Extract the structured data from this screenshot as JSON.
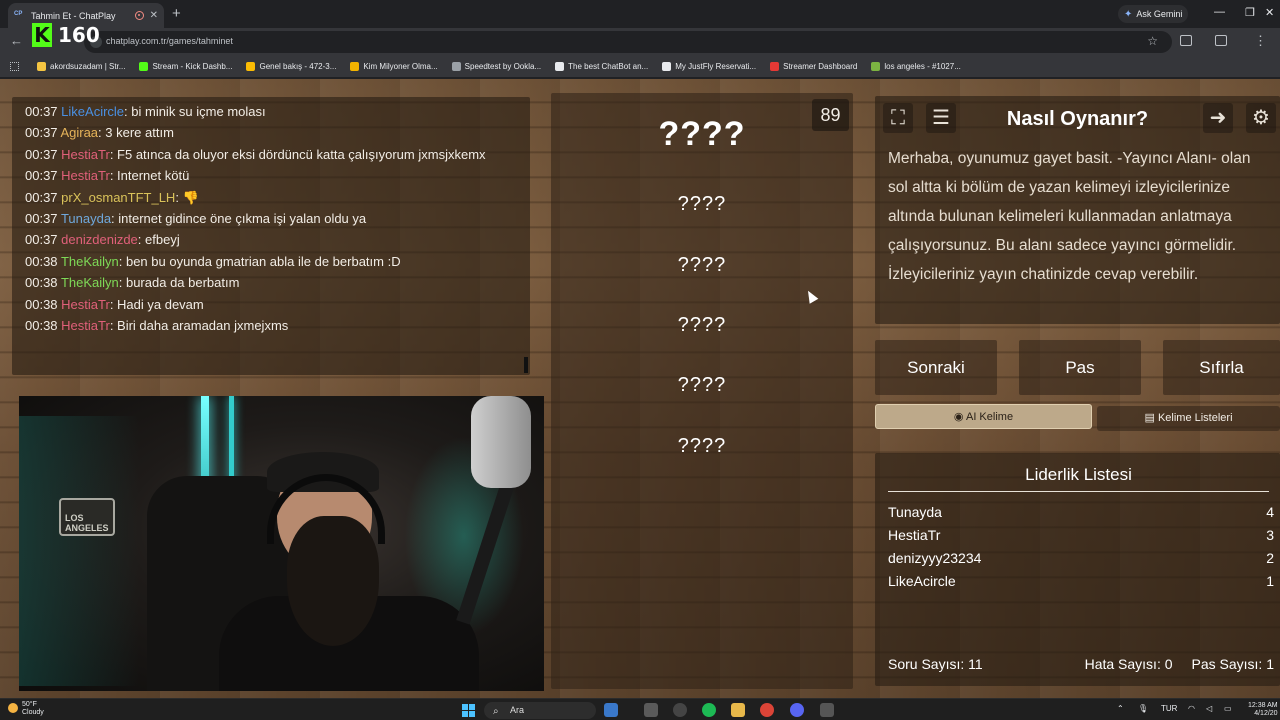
{
  "browser": {
    "tab_title": "Tahmin Et - ChatPlay",
    "tab_favicon": "CP",
    "gemini_label": "Ask Gemini",
    "url": "chatplay.com.tr/games/tahminet",
    "kick_viewers": "160",
    "bookmarks": [
      {
        "label": "akordsuzadam | Str...",
        "color": "#f5c542"
      },
      {
        "label": "Stream - Kick Dashb...",
        "color": "#53fc18"
      },
      {
        "label": "Genel bakış - 472-3...",
        "color": "#fbbc04"
      },
      {
        "label": "Kim Milyoner Olma...",
        "color": "#f4b400"
      },
      {
        "label": "Speedtest by Ookla...",
        "color": "#9aa0a6"
      },
      {
        "label": "The best ChatBot an...",
        "color": "#e8eaed"
      },
      {
        "label": "My JustFly Reservati...",
        "color": "#e8eaed"
      },
      {
        "label": "Streamer Dashboard",
        "color": "#e53935"
      },
      {
        "label": "los angeles - #1027...",
        "color": "#7cb342"
      }
    ]
  },
  "chat": {
    "messages": [
      {
        "time": "00:37",
        "user": "LikeAcircle",
        "color": "#4a90e2",
        "text": ": bi minik su içme molası"
      },
      {
        "time": "00:37",
        "user": "Agiraa",
        "color": "#e6b45a",
        "text": ": 3 kere attım"
      },
      {
        "time": "00:37",
        "user": "HestiaTr",
        "color": "#e0607a",
        "text": ": F5 atınca da oluyor eksi dördüncü katta çalışıyorum jxmsjxkemx"
      },
      {
        "time": "00:37",
        "user": "HestiaTr",
        "color": "#e0607a",
        "text": ": Internet kötü"
      },
      {
        "time": "00:37",
        "user": "prX_osmanTFT_LH",
        "color": "#d9c25a",
        "text": ": 👎"
      },
      {
        "time": "00:37",
        "user": "Tunayda",
        "color": "#6fa8dc",
        "text": ": internet gidince öne çıkma işi yalan oldu ya"
      },
      {
        "time": "00:37",
        "user": "denizdenizde",
        "color": "#e0607a",
        "text": ": efbeyj"
      },
      {
        "time": "00:38",
        "user": "TheKailyn",
        "color": "#7ed957",
        "text": ": ben bu oyunda gmatrian abla ile de berbatım :D"
      },
      {
        "time": "00:38",
        "user": "TheKailyn",
        "color": "#7ed957",
        "text": ": burada da berbatım"
      },
      {
        "time": "00:38",
        "user": "HestiaTr",
        "color": "#e0607a",
        "text": ": Hadi ya devam"
      },
      {
        "time": "00:38",
        "user": "HestiaTr",
        "color": "#e0607a",
        "text": ": Biri daha aramadan jxmejxms"
      }
    ]
  },
  "webcam": {
    "sign_text": "LOS ANGELES"
  },
  "game": {
    "timer": "89",
    "main_word": "????",
    "forbidden_words": [
      "????",
      "????",
      "????",
      "????",
      "????"
    ]
  },
  "info": {
    "title": "Nasıl Oynanır?",
    "description": "Merhaba, oyunumuz gayet basit. -Yayıncı Alanı- olan sol altta ki bölüm de yazan kelimeyi izleyicilerinize altında bulunan kelimeleri kullanmadan anlatmaya çalışıyorsunuz. Bu alanı sadece yayıncı görmelidir. İzleyicileriniz yayın chatinizde cevap verebilir."
  },
  "controls": {
    "next": "Sonraki",
    "pass": "Pas",
    "reset": "Sıfırla",
    "ai_word": "AI Kelime",
    "word_lists": "Kelime Listeleri"
  },
  "leaderboard": {
    "title": "Liderlik Listesi",
    "rows": [
      {
        "name": "Tunayda",
        "score": "4"
      },
      {
        "name": "HestiaTr",
        "score": "3"
      },
      {
        "name": "denizyyy23234",
        "score": "2"
      },
      {
        "name": "LikeAcircle",
        "score": "1"
      }
    ],
    "question_count": "Soru Sayısı: 11",
    "error_count": "Hata Sayısı: 0",
    "pass_count": "Pas Sayısı: 1"
  },
  "taskbar": {
    "temp": "50°F",
    "weather": "Cloudy",
    "search_placeholder": "Ara",
    "lang": "TUR",
    "time": "12:38 AM",
    "date": "4/12/20"
  }
}
